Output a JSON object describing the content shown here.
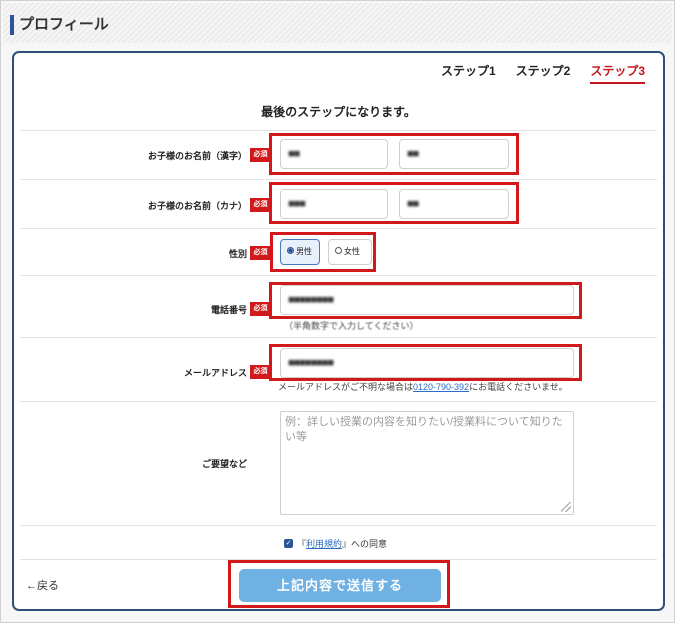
{
  "page": {
    "title": "プロフィール"
  },
  "steps": [
    "ステップ1",
    "ステップ2",
    "ステップ3"
  ],
  "active_step": 3,
  "lead_text": "最後のステップになります。",
  "required_badge": "必須",
  "fields": {
    "child_name_kanji": {
      "label": "お子様のお名前（漢字）",
      "last": "■■",
      "first": "■■"
    },
    "child_name_kana": {
      "label": "お子様のお名前（カナ）",
      "last": "■■■",
      "first": "■■"
    },
    "gender": {
      "label": "性別",
      "options": [
        "男性",
        "女性"
      ],
      "selected": "男性"
    },
    "phone": {
      "label": "電話番号",
      "value": "■■■■■■■■",
      "hint": "（半角数字で入力してください）"
    },
    "email": {
      "label": "メールアドレス",
      "value": "■■■■■■■■",
      "hint_before": "メールアドレスがご不明な場合は",
      "hint_phone": "0120-790-392",
      "hint_after": "にお電話くださいませ。"
    },
    "request": {
      "label": "ご要望など",
      "placeholder": "例：詳しい授業の内容を知りたい/授業料について知りたい等"
    }
  },
  "agreement": {
    "link": "利用規約",
    "suffix": "への同意",
    "open": "『",
    "close": "』"
  },
  "buttons": {
    "back": "←戻る",
    "submit": "上記内容で送信する"
  },
  "colors": {
    "accent_red": "#d3181b",
    "navy": "#2d4f7a",
    "submit_blue": "#6fb1e3"
  }
}
